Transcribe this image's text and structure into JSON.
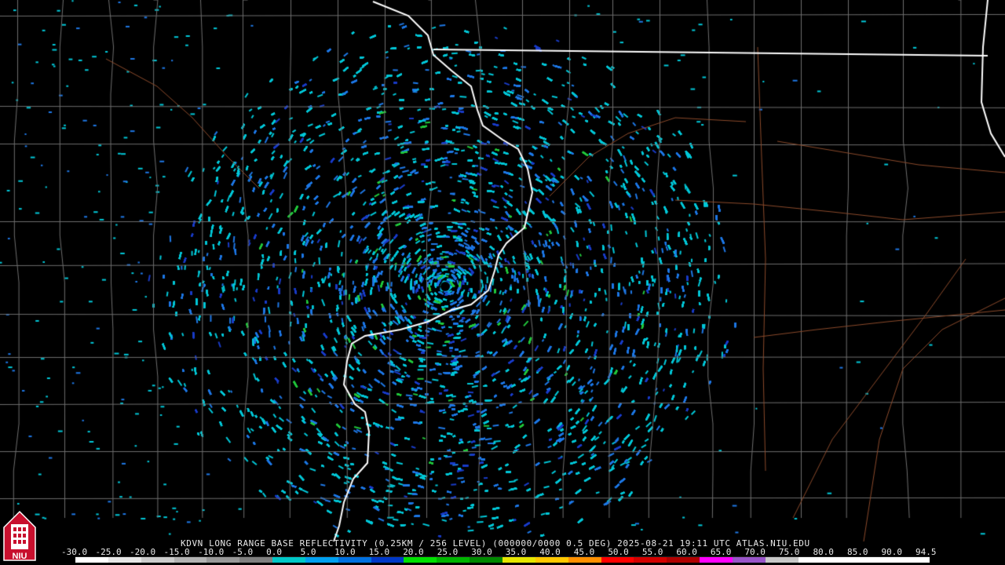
{
  "product": {
    "title": "KDVN LONG RANGE BASE REFLECTIVITY (0.25KM / 256 LEVEL) (000000/0000 0.5 DEG) 2025-08-21 19:11 UTC  ATLAS.NIU.EDU"
  },
  "logo": {
    "text": "NIU",
    "icon": "niu-tower-logo-icon",
    "color": "#c8102e"
  },
  "colorbar": {
    "labels": [
      "-30.0",
      "-25.0",
      "-20.0",
      "-15.0",
      "-10.0",
      "-5.0",
      "0.0",
      "5.0",
      "10.0",
      "15.0",
      "20.0",
      "25.0",
      "30.0",
      "35.0",
      "40.0",
      "45.0",
      "50.0",
      "55.0",
      "60.0",
      "65.0",
      "70.0",
      "75.0",
      "80.0",
      "85.0",
      "90.0",
      "94.5"
    ],
    "colors": [
      "#ffffff",
      "#e6e6e6",
      "#cccccc",
      "#b3b3b3",
      "#999999",
      "#808080",
      "#00c8c8",
      "#00a0f0",
      "#0070e0",
      "#0038c8",
      "#00e000",
      "#00b400",
      "#008800",
      "#e6e600",
      "#ffc800",
      "#ff9000",
      "#ff0000",
      "#d40000",
      "#b00000",
      "#ff00ff",
      "#9955c9",
      "#c8c8c8",
      "#ffffff",
      "#ffffff",
      "#ffffff",
      "#ffffff"
    ]
  },
  "map": {
    "radar_site": "KDVN",
    "colors": {
      "background": "#000000",
      "county_lines": "#6e6e6e",
      "state_lines": "#ffffff",
      "highways": "#8b4a2b",
      "echo_light": "#00c8d8",
      "echo_mid": "#1e78e6",
      "echo_dark": "#1a3cc8",
      "echo_green": "#22c83c"
    }
  }
}
